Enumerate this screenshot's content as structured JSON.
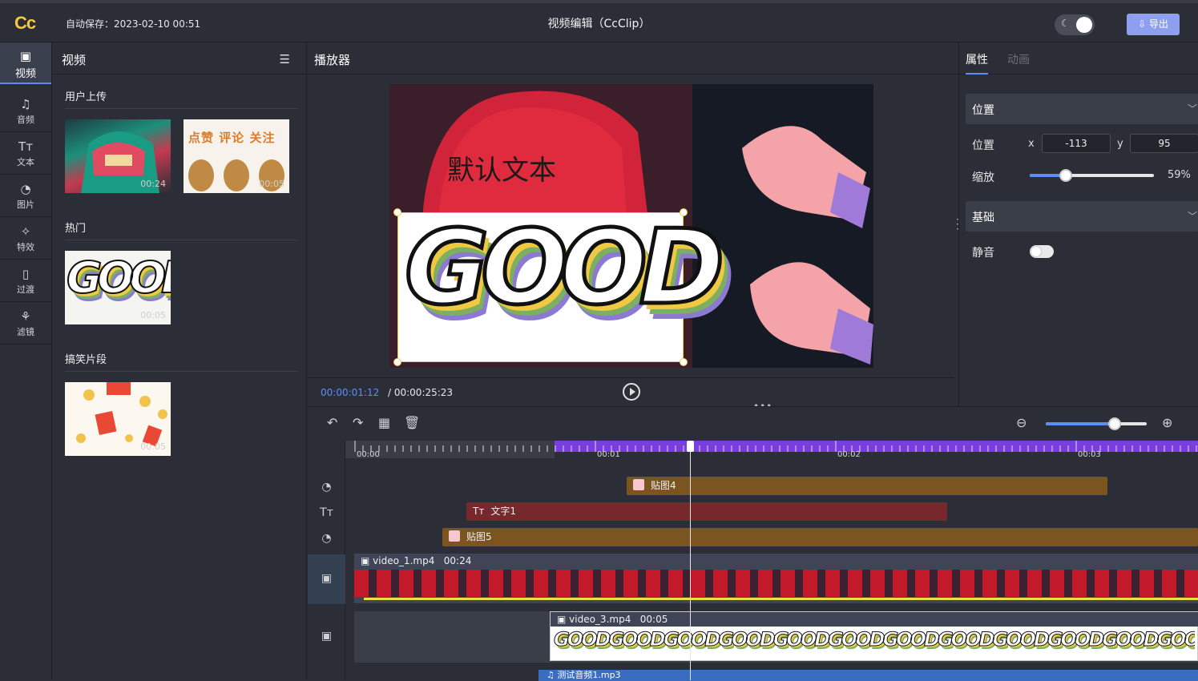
{
  "header": {
    "logo": "Cc",
    "autosave": "自动保存：2023-02-10 00:51",
    "title": "视频编辑（CcClip）",
    "theme_icon": "moon-icon",
    "export_label": "⇩ 导出"
  },
  "rail": {
    "items": [
      {
        "label": "视频",
        "icon": "video-icon",
        "glyph": "▣"
      },
      {
        "label": "音频",
        "icon": "audio-icon",
        "glyph": "♫"
      },
      {
        "label": "文本",
        "icon": "text-icon",
        "glyph": "Tт"
      },
      {
        "label": "图片",
        "icon": "image-icon",
        "glyph": "◔"
      },
      {
        "label": "特效",
        "icon": "effect-icon",
        "glyph": "✧"
      },
      {
        "label": "过渡",
        "icon": "transition-icon",
        "glyph": "▯"
      },
      {
        "label": "滤镜",
        "icon": "filter-icon",
        "glyph": "⚘"
      }
    ]
  },
  "library": {
    "title": "视频",
    "sections": [
      {
        "title": "用户上传",
        "items": [
          {
            "duration": "00:24"
          },
          {
            "duration": "00:05",
            "caption": [
              "点赞",
              "评论",
              "关注"
            ]
          }
        ]
      },
      {
        "title": "热门",
        "items": [
          {
            "duration": "00:05",
            "caption": "GOOD"
          }
        ]
      },
      {
        "title": "搞笑片段",
        "items": [
          {
            "duration": "00:05"
          }
        ]
      }
    ]
  },
  "player": {
    "title": "播放器",
    "overlay_text": "默认文本",
    "good_text": "GOOD",
    "current_time": "00:00:01:12",
    "total_time": "/  00:00:25:23"
  },
  "properties": {
    "tabs": [
      "属性",
      "动画"
    ],
    "position_group": "位置",
    "position_label": "位置",
    "x_label": "x",
    "x_value": "-113",
    "y_label": "y",
    "y_value": "95",
    "scale_label": "缩放",
    "scale_value": "59%",
    "scale_fraction": 0.29,
    "basic_group": "基础",
    "mute_label": "静音"
  },
  "timeline": {
    "zoom_fraction": 0.68,
    "ruler_labels": [
      "00:00",
      "00:01",
      "00:02",
      "00:03"
    ],
    "clips": [
      {
        "label": "贴图4",
        "color": "#7b5420"
      },
      {
        "label": "文字1",
        "color": "#76282c",
        "glyph": "Tт"
      },
      {
        "label": "贴图5",
        "color": "#7b5420"
      }
    ],
    "video_tracks": [
      {
        "name": "video_1.mp4",
        "duration": "00:24"
      },
      {
        "name": "video_3.mp4",
        "duration": "00:05"
      }
    ],
    "audio_clip": "测试音频1.mp3"
  },
  "colors": {
    "accent": "#5b8ff7",
    "purple": "#7a3ee0",
    "logo": "#f3c93f"
  }
}
